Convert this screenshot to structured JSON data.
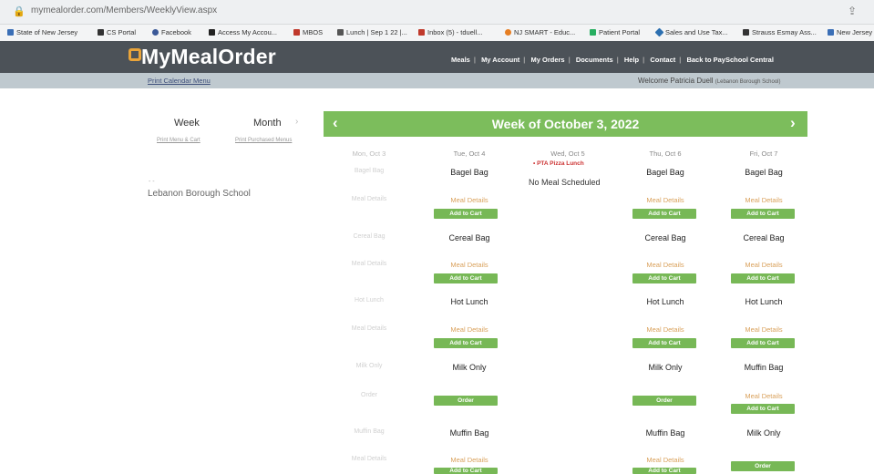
{
  "browser": {
    "url": "mymealorder.com/Members/WeeklyView.aspx",
    "bookmarks": [
      {
        "label": "State of New Jersey",
        "color": "#3b6fb6"
      },
      {
        "label": "CS Portal",
        "color": "#333333"
      },
      {
        "label": "Facebook",
        "color": "#3b5998"
      },
      {
        "label": "Access My Accou...",
        "color": "#222222"
      },
      {
        "label": "MBOS",
        "color": "#c0392b"
      },
      {
        "label": "Lunch | Sep 1 22 |...",
        "color": "#555555"
      },
      {
        "label": "Inbox (5) - tduell...",
        "color": "#c0392b"
      },
      {
        "label": "NJ SMART - Educ...",
        "color": "#e67e22"
      },
      {
        "label": "Patient Portal",
        "color": "#27ae60"
      },
      {
        "label": "Sales and Use Tax...",
        "color": "#2c6fb0"
      },
      {
        "label": "Strauss Esmay Ass...",
        "color": "#333333"
      },
      {
        "label": "New Jersey",
        "color": "#3b6fb6"
      }
    ]
  },
  "header": {
    "logo": "MyMealOrder",
    "nav": [
      "Meals",
      "My Account",
      "My Orders",
      "Documents",
      "Help",
      "Contact",
      "Back to PaySchool Central"
    ]
  },
  "subbar": {
    "print_link": "Print Calendar Menu",
    "welcome": "Welcome Patricia Duell",
    "school_note": "(Lebanon Borough School)"
  },
  "left": {
    "tab_week": "Week",
    "tab_month": "Month",
    "tab_month_arrow": "›",
    "link_left": "Print Menu & Cart",
    "link_right": "Print Purchased Menus",
    "dash": "- -",
    "school": "Lebanon Borough School"
  },
  "week": {
    "title": "Week of October 3, 2022",
    "prev": "‹",
    "next": "›",
    "days": [
      {
        "label": "Mon, Oct 3"
      },
      {
        "label": "Tue, Oct 4"
      },
      {
        "label": "Wed, Oct 5"
      },
      {
        "label": "Thu, Oct 6"
      },
      {
        "label": "Fri, Oct 7"
      }
    ],
    "wed_event": "PTA Pizza Lunch",
    "wed_note": "No Meal Scheduled",
    "mon_items": [
      "Bagel Bag",
      "Meal Details",
      "Cereal Bag",
      "Meal Details",
      "Hot Lunch",
      "Meal Details",
      "Milk Only",
      "Order",
      "Muffin Bag",
      "Meal Details"
    ],
    "tue": [
      "Bagel Bag",
      "Cereal Bag",
      "Hot Lunch",
      "Milk Only",
      "Muffin Bag"
    ],
    "thu": [
      "Bagel Bag",
      "Cereal Bag",
      "Hot Lunch",
      "Milk Only",
      "Muffin Bag"
    ],
    "fri": [
      "Bagel Bag",
      "Cereal Bag",
      "Hot Lunch",
      "Muffin Bag",
      "Milk Only"
    ],
    "meal_details": "Meal Details",
    "add_to_cart": "Add to Cart",
    "order": "Order"
  }
}
